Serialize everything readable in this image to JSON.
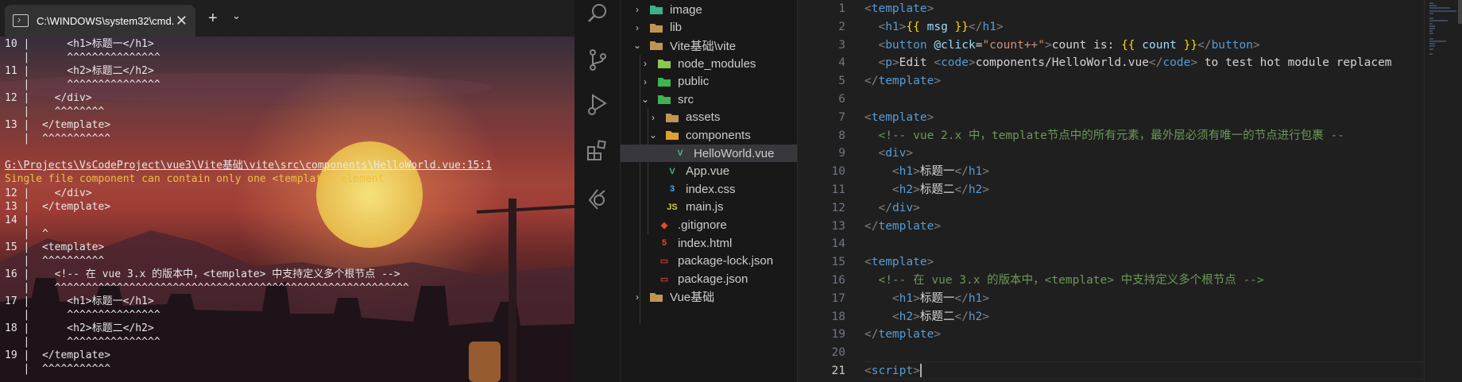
{
  "terminal": {
    "tab_title": "C:\\WINDOWS\\system32\\cmd.",
    "close_glyph": "✕",
    "new_tab_glyph": "+",
    "dropdown_glyph": "⌄",
    "lines": [
      {
        "text": "10 |      <h1>标题一</h1>",
        "cls": ""
      },
      {
        "text": "   |      ^^^^^^^^^^^^^^^",
        "cls": ""
      },
      {
        "text": "11 |      <h2>标题二</h2>",
        "cls": ""
      },
      {
        "text": "   |      ^^^^^^^^^^^^^^^",
        "cls": ""
      },
      {
        "text": "12 |    </div>",
        "cls": ""
      },
      {
        "text": "   |    ^^^^^^^^",
        "cls": ""
      },
      {
        "text": "13 |  </template>",
        "cls": ""
      },
      {
        "text": "   |  ^^^^^^^^^^^",
        "cls": ""
      },
      {
        "text": "",
        "cls": ""
      },
      {
        "text": "G:\\Projects\\VsCodeProject\\vue3\\Vite基础\\vite\\src\\components\\HelloWorld.vue:15:1",
        "cls": "path"
      },
      {
        "text": "Single file component can contain only one <template> element",
        "cls": "err"
      },
      {
        "text": "12 |    </div>",
        "cls": ""
      },
      {
        "text": "13 |  </template>",
        "cls": ""
      },
      {
        "text": "14 |",
        "cls": ""
      },
      {
        "text": "   |  ^",
        "cls": ""
      },
      {
        "text": "15 |  <template>",
        "cls": ""
      },
      {
        "text": "   |  ^^^^^^^^^^",
        "cls": ""
      },
      {
        "text": "16 |    <!-- 在 vue 3.x 的版本中，<template> 中支持定义多个根节点 -->",
        "cls": ""
      },
      {
        "text": "   |    ^^^^^^^^^^^^^^^^^^^^^^^^^^^^^^^^^^^^^^^^^^^^^^^^^^^^^^^^^",
        "cls": ""
      },
      {
        "text": "17 |      <h1>标题一</h1>",
        "cls": ""
      },
      {
        "text": "   |      ^^^^^^^^^^^^^^^",
        "cls": ""
      },
      {
        "text": "18 |      <h2>标题二</h2>",
        "cls": ""
      },
      {
        "text": "   |      ^^^^^^^^^^^^^^^",
        "cls": ""
      },
      {
        "text": "19 |  </template>",
        "cls": ""
      },
      {
        "text": "   |  ^^^^^^^^^^^",
        "cls": ""
      }
    ]
  },
  "activity_bar": [
    "search-icon",
    "source-control-icon",
    "run-debug-icon",
    "extensions-icon",
    "remote-explorer-icon"
  ],
  "explorer": {
    "items": [
      {
        "label": "image",
        "chevron": "›",
        "icon": "image-folder",
        "depth": 1,
        "icon_color": "#3fae8a"
      },
      {
        "label": "lib",
        "chevron": "›",
        "icon": "folder",
        "depth": 1,
        "icon_color": "#c09553"
      },
      {
        "label": "Vite基础\\vite",
        "chevron": "⌄",
        "icon": "folder-open",
        "depth": 1,
        "icon_color": "#c09553"
      },
      {
        "label": "node_modules",
        "chevron": "›",
        "icon": "node-folder",
        "depth": 2,
        "icon_color": "#8cc84b"
      },
      {
        "label": "public",
        "chevron": "›",
        "icon": "public-folder",
        "depth": 2,
        "icon_color": "#3fb34f"
      },
      {
        "label": "src",
        "chevron": "⌄",
        "icon": "src-folder",
        "depth": 2,
        "icon_color": "#3fb34f"
      },
      {
        "label": "assets",
        "chevron": "›",
        "icon": "folder",
        "depth": 3,
        "icon_color": "#c09553"
      },
      {
        "label": "components",
        "chevron": "⌄",
        "icon": "folder-open",
        "depth": 3,
        "icon_color": "#e0a030"
      },
      {
        "label": "HelloWorld.vue",
        "chevron": "",
        "icon": "vue",
        "depth": 4,
        "icon_color": "#41b883",
        "selected": true
      },
      {
        "label": "App.vue",
        "chevron": "",
        "icon": "vue",
        "depth": 3,
        "icon_color": "#41b883"
      },
      {
        "label": "index.css",
        "chevron": "",
        "icon": "css",
        "depth": 3,
        "icon_color": "#42a5f5"
      },
      {
        "label": "main.js",
        "chevron": "",
        "icon": "js",
        "depth": 3,
        "icon_color": "#cbcb41"
      },
      {
        "label": ".gitignore",
        "chevron": "",
        "icon": "git",
        "depth": 2,
        "icon_color": "#e44d26"
      },
      {
        "label": "index.html",
        "chevron": "",
        "icon": "html",
        "depth": 2,
        "icon_color": "#e44d26"
      },
      {
        "label": "package-lock.json",
        "chevron": "",
        "icon": "npm",
        "depth": 2,
        "icon_color": "#cb3837"
      },
      {
        "label": "package.json",
        "chevron": "",
        "icon": "npm",
        "depth": 2,
        "icon_color": "#cb3837"
      },
      {
        "label": "Vue基础",
        "chevron": "›",
        "icon": "folder",
        "depth": 1,
        "icon_color": "#c09553"
      }
    ],
    "icon_glyphs": {
      "vue": "V",
      "css": "3",
      "js": "JS",
      "html": "5",
      "git": "◆",
      "npm": "▭"
    }
  },
  "editor": {
    "current_line": 21,
    "lines": [
      [
        [
          "t",
          "<"
        ],
        [
          "tg",
          "template"
        ],
        [
          "t",
          ">"
        ]
      ],
      [
        [
          "pl",
          "  "
        ],
        [
          "t",
          "<"
        ],
        [
          "tg",
          "h1"
        ],
        [
          "t",
          ">"
        ],
        [
          "br",
          "{{"
        ],
        [
          "vr",
          " msg "
        ],
        [
          "br",
          "}}"
        ],
        [
          "t",
          "</"
        ],
        [
          "tg",
          "h1"
        ],
        [
          "t",
          ">"
        ]
      ],
      [
        [
          "pl",
          "  "
        ],
        [
          "t",
          "<"
        ],
        [
          "tg",
          "button"
        ],
        [
          "at",
          " @click"
        ],
        [
          "pl",
          "="
        ],
        [
          "st",
          "\"count++\""
        ],
        [
          "t",
          ">"
        ],
        [
          "pl",
          "count is: "
        ],
        [
          "br",
          "{{"
        ],
        [
          "vr",
          " count "
        ],
        [
          "br",
          "}}"
        ],
        [
          "t",
          "</"
        ],
        [
          "tg",
          "button"
        ],
        [
          "t",
          ">"
        ]
      ],
      [
        [
          "pl",
          "  "
        ],
        [
          "t",
          "<"
        ],
        [
          "tg",
          "p"
        ],
        [
          "t",
          ">"
        ],
        [
          "pl",
          "Edit "
        ],
        [
          "t",
          "<"
        ],
        [
          "tg",
          "code"
        ],
        [
          "t",
          ">"
        ],
        [
          "pl",
          "components/HelloWorld.vue"
        ],
        [
          "t",
          "</"
        ],
        [
          "tg",
          "code"
        ],
        [
          "t",
          ">"
        ],
        [
          "pl",
          " to test hot module replacem"
        ]
      ],
      [
        [
          "t",
          "</"
        ],
        [
          "tg",
          "template"
        ],
        [
          "t",
          ">"
        ]
      ],
      [],
      [
        [
          "t",
          "<"
        ],
        [
          "tg",
          "template"
        ],
        [
          "t",
          ">"
        ]
      ],
      [
        [
          "pl",
          "  "
        ],
        [
          "cm",
          "<!-- vue 2.x 中，template节点中的所有元素，最外层必须有唯一的节点进行包裹 --"
        ]
      ],
      [
        [
          "pl",
          "  "
        ],
        [
          "t",
          "<"
        ],
        [
          "tg",
          "div"
        ],
        [
          "t",
          ">"
        ]
      ],
      [
        [
          "pl",
          "    "
        ],
        [
          "t",
          "<"
        ],
        [
          "tg",
          "h1"
        ],
        [
          "t",
          ">"
        ],
        [
          "pl",
          "标题一"
        ],
        [
          "t",
          "</"
        ],
        [
          "tg",
          "h1"
        ],
        [
          "t",
          ">"
        ]
      ],
      [
        [
          "pl",
          "    "
        ],
        [
          "t",
          "<"
        ],
        [
          "tg",
          "h2"
        ],
        [
          "t",
          ">"
        ],
        [
          "pl",
          "标题二"
        ],
        [
          "t",
          "</"
        ],
        [
          "tg",
          "h2"
        ],
        [
          "t",
          ">"
        ]
      ],
      [
        [
          "pl",
          "  "
        ],
        [
          "t",
          "</"
        ],
        [
          "tg",
          "div"
        ],
        [
          "t",
          ">"
        ]
      ],
      [
        [
          "t",
          "</"
        ],
        [
          "tg",
          "template"
        ],
        [
          "t",
          ">"
        ]
      ],
      [],
      [
        [
          "t",
          "<"
        ],
        [
          "tg",
          "template"
        ],
        [
          "t",
          ">"
        ]
      ],
      [
        [
          "pl",
          "  "
        ],
        [
          "cm",
          "<!-- 在 vue 3.x 的版本中，<template> 中支持定义多个根节点 -->"
        ]
      ],
      [
        [
          "pl",
          "    "
        ],
        [
          "t",
          "<"
        ],
        [
          "tg",
          "h1"
        ],
        [
          "t",
          ">"
        ],
        [
          "pl",
          "标题一"
        ],
        [
          "t",
          "</"
        ],
        [
          "tg",
          "h1"
        ],
        [
          "t",
          ">"
        ]
      ],
      [
        [
          "pl",
          "    "
        ],
        [
          "t",
          "<"
        ],
        [
          "tg",
          "h2"
        ],
        [
          "t",
          ">"
        ],
        [
          "pl",
          "标题二"
        ],
        [
          "t",
          "</"
        ],
        [
          "tg",
          "h2"
        ],
        [
          "t",
          ">"
        ]
      ],
      [
        [
          "t",
          "</"
        ],
        [
          "tg",
          "template"
        ],
        [
          "t",
          ">"
        ]
      ],
      [],
      [
        [
          "t",
          "<"
        ],
        [
          "tg",
          "script"
        ],
        [
          "t",
          ">"
        ]
      ]
    ]
  }
}
